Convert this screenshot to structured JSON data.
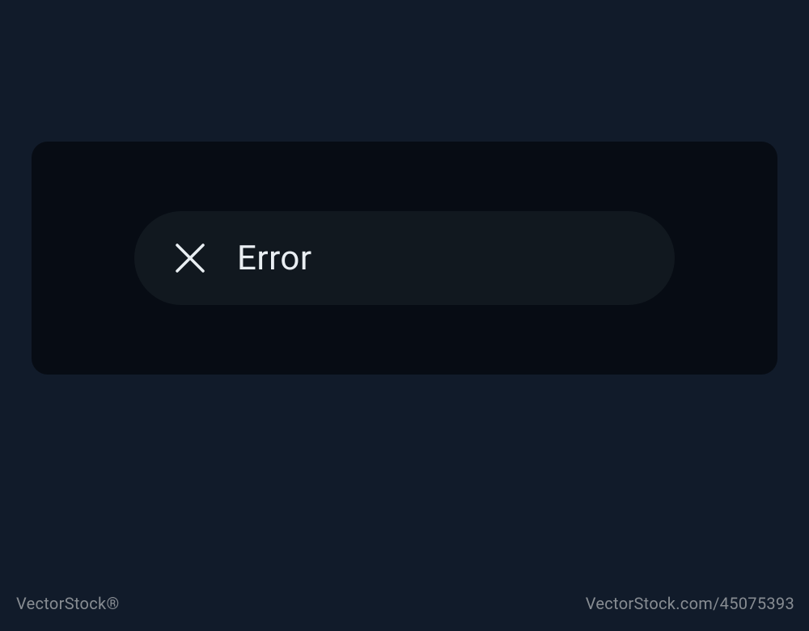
{
  "message": {
    "text": "Error"
  },
  "watermark": {
    "left": "VectorStock®",
    "right": "VectorStock.com/45075393"
  }
}
